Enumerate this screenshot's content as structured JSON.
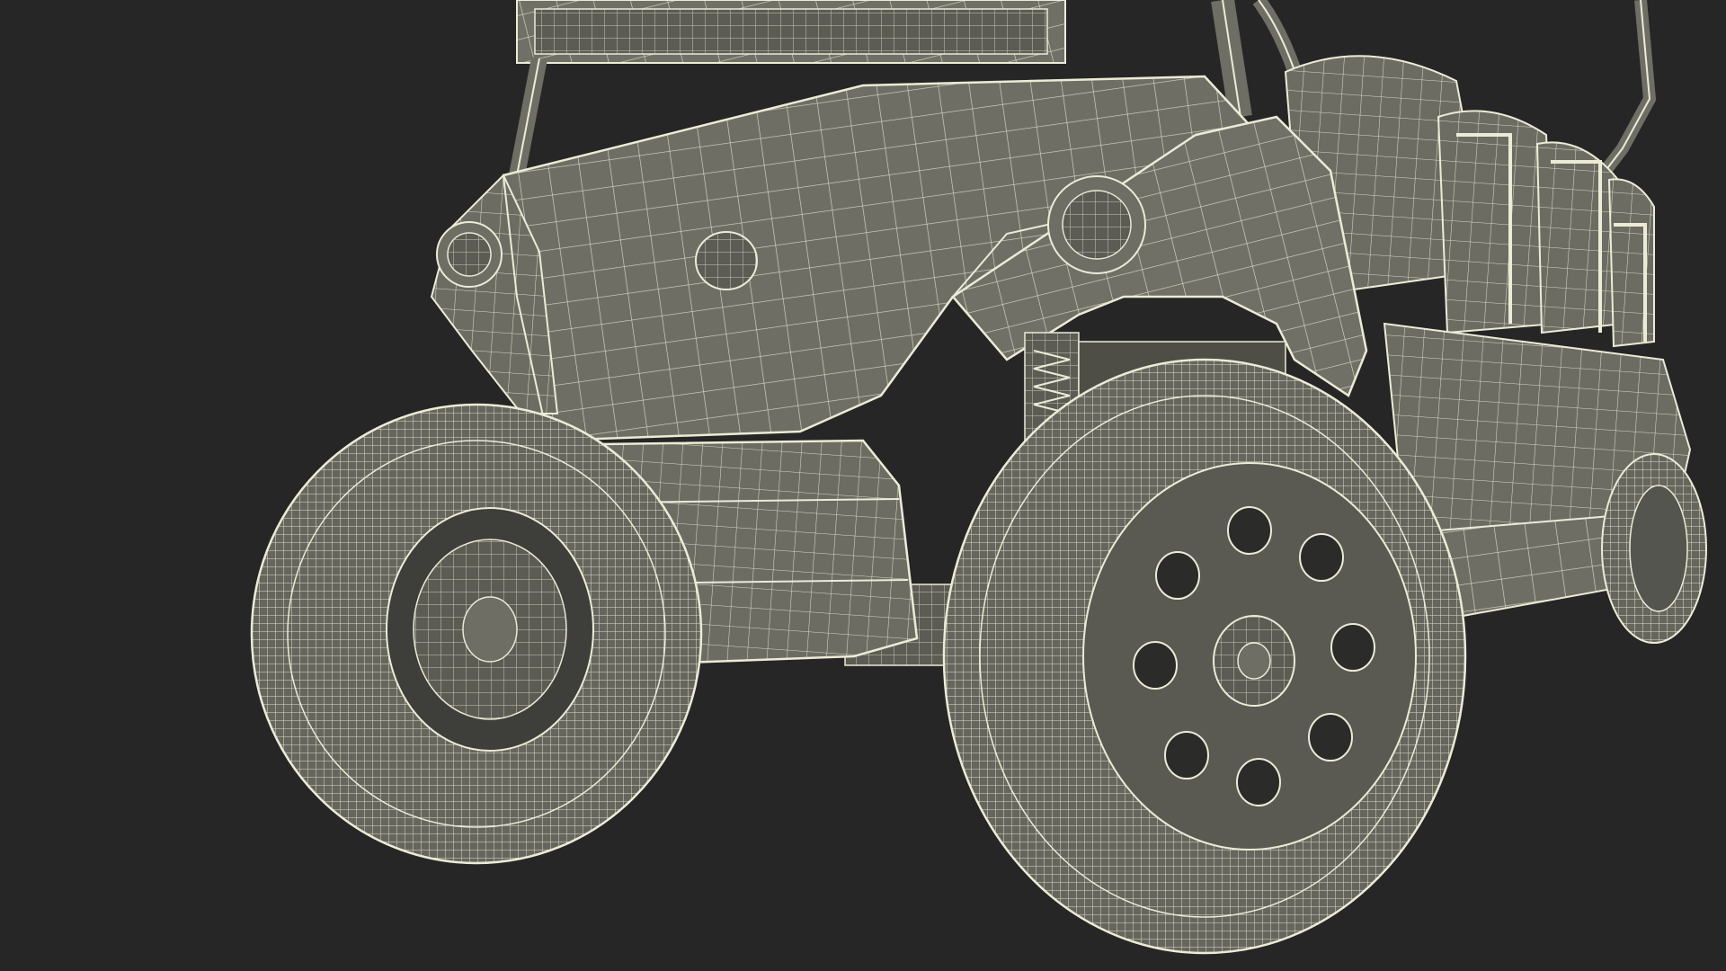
{
  "scene": {
    "subject": "wireframe-golf-cart",
    "background_color": "#262626",
    "surface_color": "#6f6f66",
    "surface_dark": "#4e4e47",
    "wire_color": "#ecebd6",
    "wire_dim": "#c9c8b2"
  }
}
